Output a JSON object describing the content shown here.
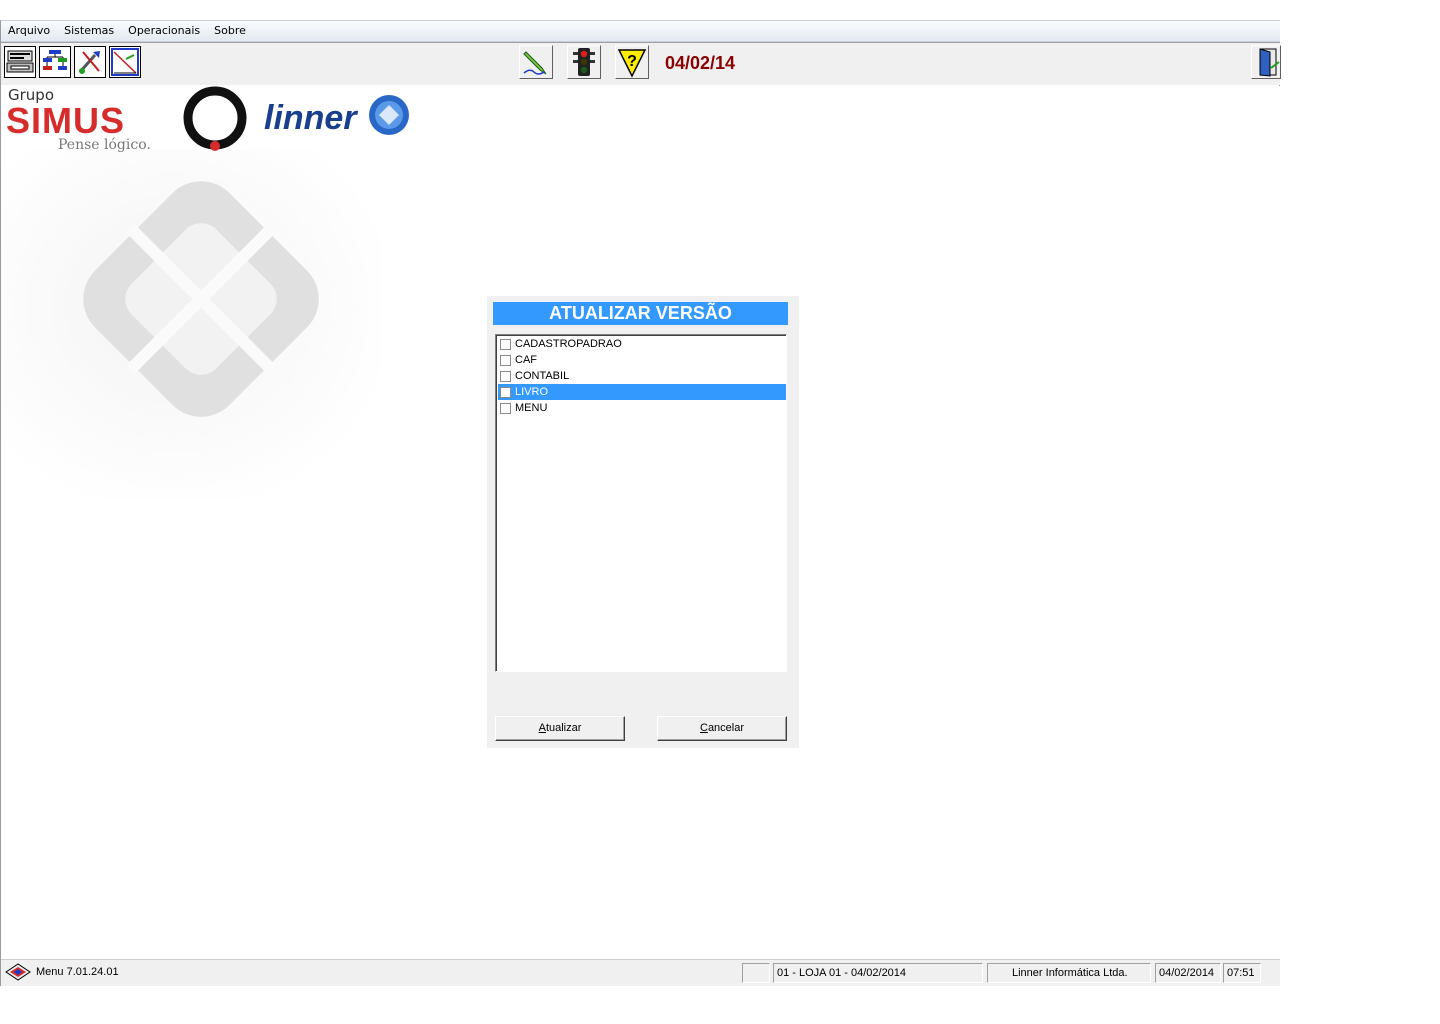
{
  "menu": {
    "items": [
      {
        "label": "Arquivo"
      },
      {
        "label": "Sistemas"
      },
      {
        "label": "Operacionais"
      },
      {
        "label": "Sobre"
      }
    ]
  },
  "toolbar": {
    "date": "04/02/14",
    "left_icons": [
      "printer-form-icon",
      "network-hierarchy-icon",
      "tools-icon",
      "chart-icon"
    ],
    "center_icons": [
      "pen-sign-icon",
      "traffic-light-icon",
      "help-icon"
    ],
    "right_icon": "exit-door-icon"
  },
  "branding": {
    "grupo": "Grupo",
    "simus": "SIMUS",
    "tagline": "Pense lógico.",
    "linner": "linner"
  },
  "dialog": {
    "title": "ATUALIZAR VERSÃO",
    "items": [
      {
        "label": "CADASTROPADRAO",
        "checked": false,
        "selected": false
      },
      {
        "label": "CAF",
        "checked": false,
        "selected": false
      },
      {
        "label": "CONTABIL",
        "checked": false,
        "selected": false
      },
      {
        "label": "LIVRO",
        "checked": false,
        "selected": true
      },
      {
        "label": "MENU",
        "checked": false,
        "selected": false
      }
    ],
    "update_button": {
      "accel": "A",
      "rest": "tualizar"
    },
    "cancel_button": {
      "accel": "C",
      "rest": "ancelar"
    }
  },
  "statusbar": {
    "app_label": "Menu  7.01.24.01",
    "store": "01 - LOJA 01 - 04/02/2014",
    "company": "Linner Informática Ltda.",
    "date": "04/02/2014",
    "time": "07:51"
  },
  "colors": {
    "accent": "#3399ff",
    "date_color": "#8b0000",
    "simus_red": "#d62c2c",
    "linner_blue": "#1a3f8f"
  }
}
